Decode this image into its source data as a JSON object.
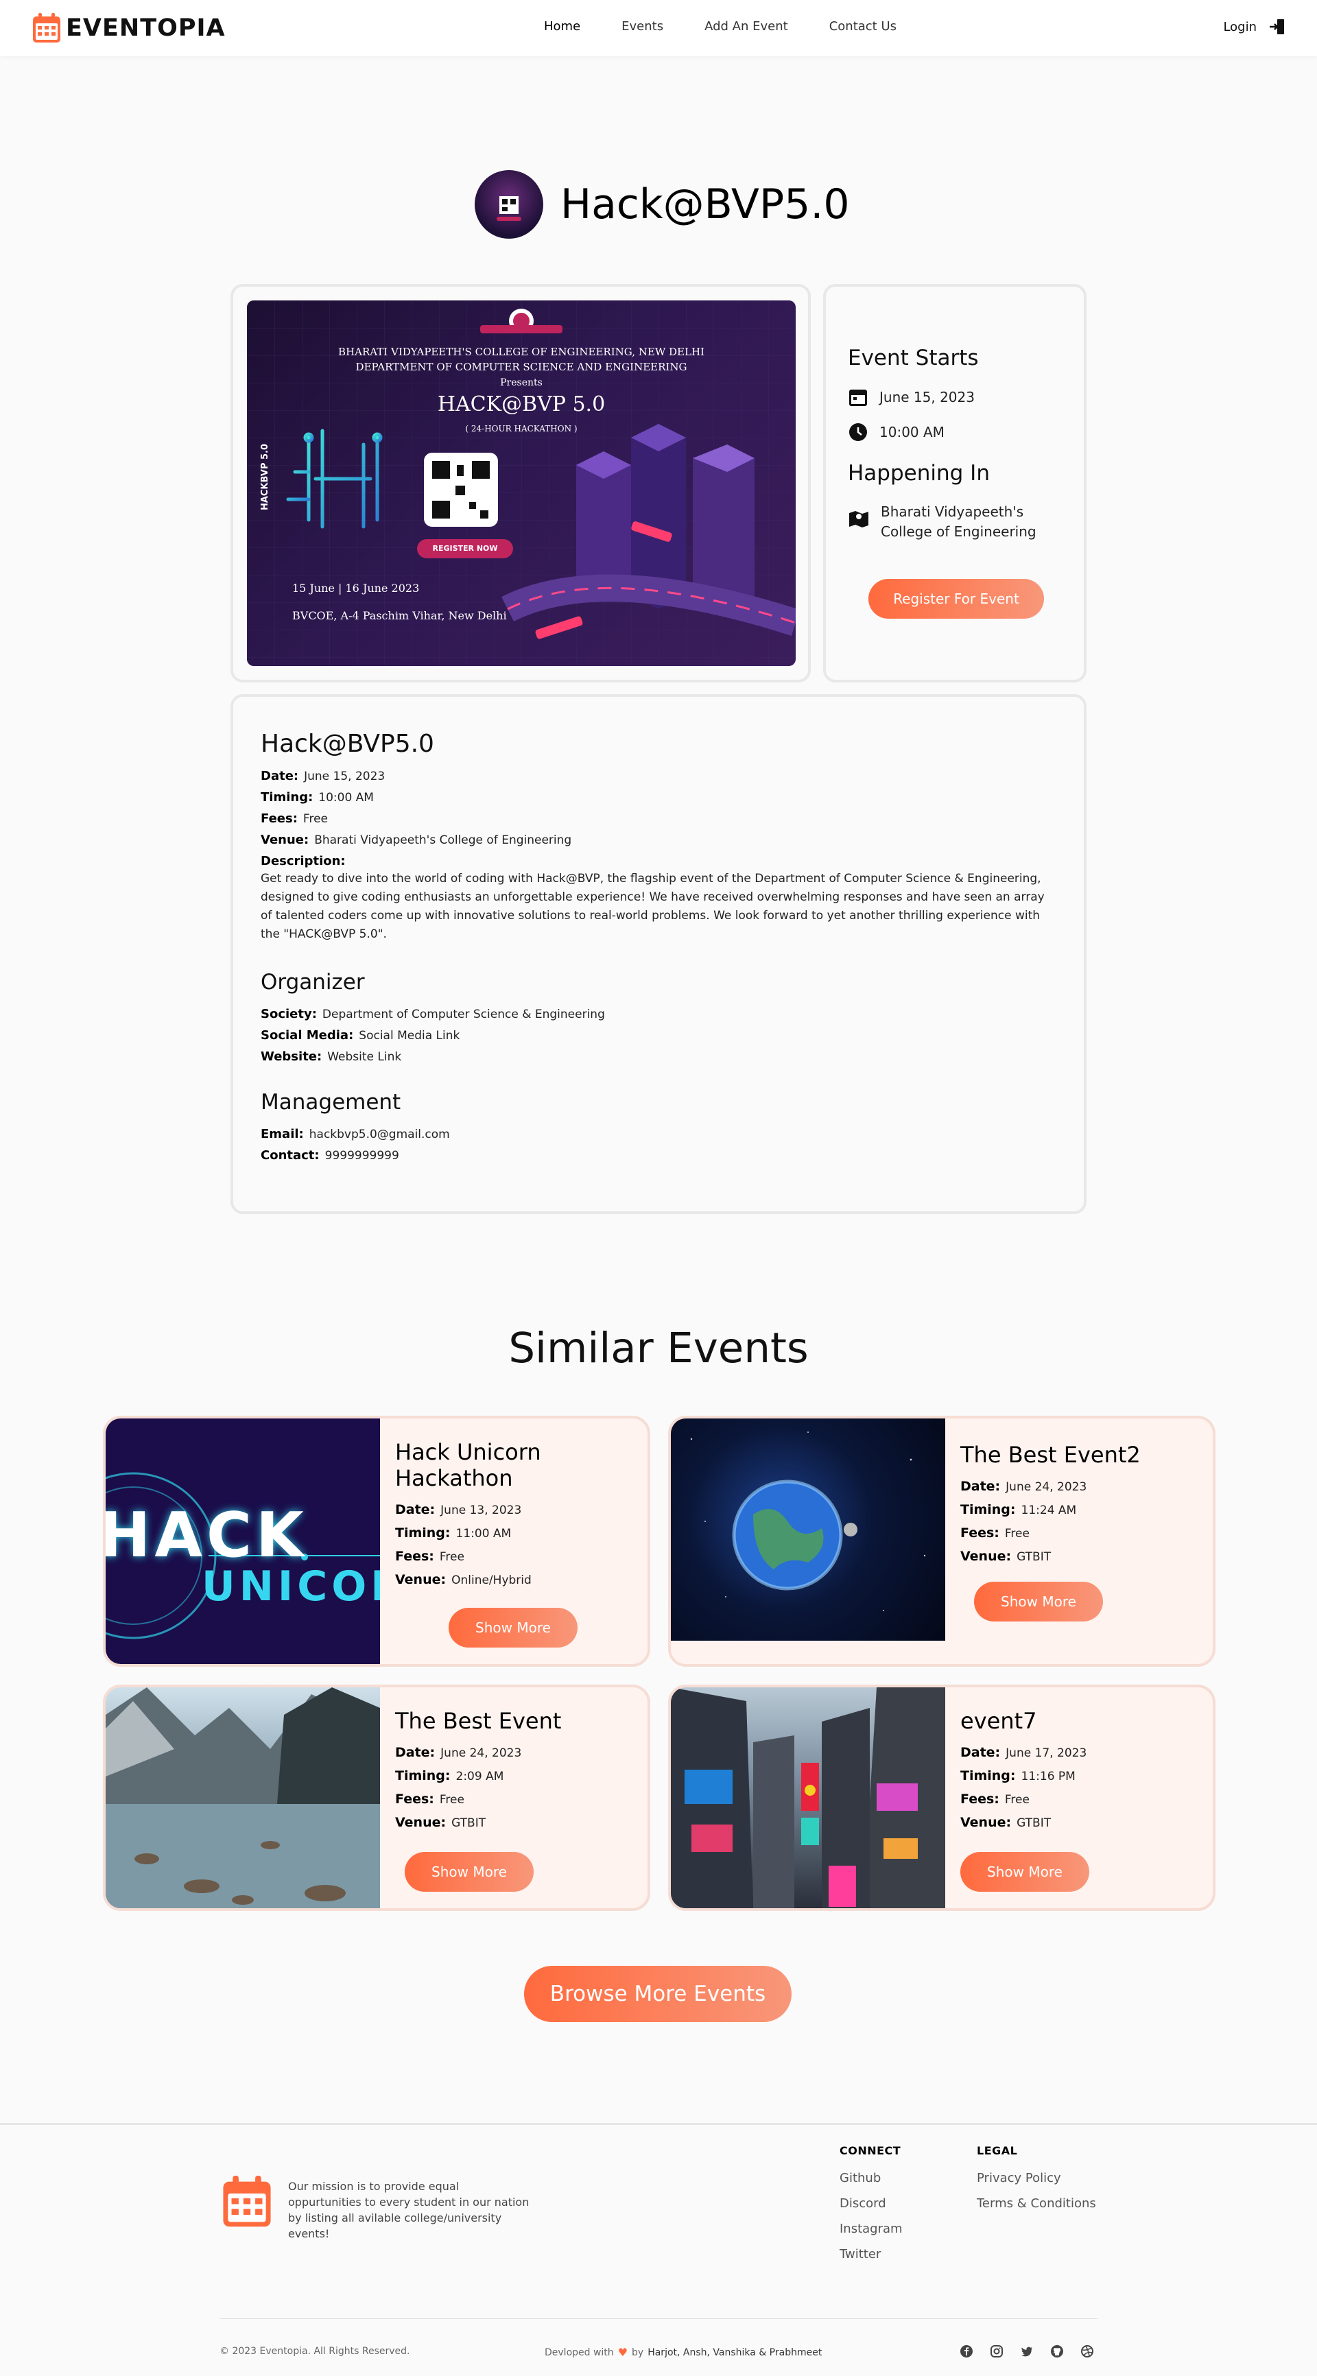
{
  "header": {
    "brand": "EVENTOPIA",
    "nav": [
      "Home",
      "Events",
      "Add An Event",
      "Contact Us"
    ],
    "login": "Login"
  },
  "event": {
    "title": "Hack@BVP5.0",
    "poster": {
      "college": "BHARATI VIDYAPEETH'S COLLEGE OF ENGINEERING, NEW DELHI",
      "dept": "DEPARTMENT OF COMPUTER SCIENCE AND ENGINEERING",
      "presents": "Presents",
      "name": "HACK@BVP 5.0",
      "sub": "( 24-HOUR HACKATHON )",
      "side": "HACKBVP 5.0",
      "register": "REGISTER NOW",
      "dates": "15 June | 16 June 2023",
      "place": "BVCOE, A-4 Paschim Vihar, New Delhi"
    },
    "starts_heading": "Event Starts",
    "start_date": "June 15, 2023",
    "start_time": "10:00 AM",
    "happening_heading": "Happening In",
    "venue_short": "Bharati Vidyapeeth's College of Engineering",
    "register_button": "Register For Event",
    "details": {
      "title": "Hack@BVP5.0",
      "date_label": "Date:",
      "date": "June 15, 2023",
      "timing_label": "Timing:",
      "timing": "10:00 AM",
      "fees_label": "Fees:",
      "fees": "Free",
      "venue_label": "Venue:",
      "venue": "Bharati Vidyapeeth's College of Engineering",
      "desc_label": "Description:",
      "description": "Get ready to dive into the world of coding with Hack@BVP, the flagship event of the Department of Computer Science & Engineering, designed to give coding enthusiasts an unforgettable experience! We have received overwhelming responses and have seen an array of talented coders come up with innovative solutions to real-world problems. We look forward to yet another thrilling experience with the \"HACK@BVP 5.0\".",
      "organizer_heading": "Organizer",
      "society_label": "Society:",
      "society": "Department of Computer Science & Engineering",
      "social_label": "Social Media:",
      "social": "Social Media Link",
      "website_label": "Website:",
      "website": "Website Link",
      "management_heading": "Management",
      "email_label": "Email:",
      "email": "hackbvp5.0@gmail.com",
      "contact_label": "Contact:",
      "contact": "9999999999"
    }
  },
  "similar": {
    "heading": "Similar Events",
    "labels": {
      "date": "Date:",
      "timing": "Timing:",
      "fees": "Fees:",
      "venue": "Venue:",
      "button": "Show More"
    },
    "events": [
      {
        "title": "Hack Unicorn Hackathon",
        "date": "June 13, 2023",
        "timing": "11:00 AM",
        "fees": "Free",
        "venue": "Online/Hybrid",
        "img_text_1": "HACK",
        "img_text_2": "UNICOI"
      },
      {
        "title": "The Best Event2",
        "date": "June 24, 2023",
        "timing": "11:24 AM",
        "fees": "Free",
        "venue": "GTBIT"
      },
      {
        "title": "The Best Event",
        "date": "June 24, 2023",
        "timing": "2:09 AM",
        "fees": "Free",
        "venue": "GTBIT"
      },
      {
        "title": "event7",
        "date": "June 17, 2023",
        "timing": "11:16 PM",
        "fees": "Free",
        "venue": "GTBIT"
      }
    ],
    "browse_button": "Browse More Events"
  },
  "footer": {
    "mission": "Our mission is to provide equal oppurtunities to every student in our nation by listing all avilable college/university events!",
    "connect_heading": "CONNECT",
    "connect": [
      "Github",
      "Discord",
      "Instagram",
      "Twitter"
    ],
    "legal_heading": "LEGAL",
    "legal": [
      "Privacy Policy",
      "Terms & Conditions"
    ],
    "copyright": "© 2023 Eventopia. All Rights Reserved.",
    "dev_prefix": "Devloped with",
    "dev_by": "by",
    "authors": "Harjot, Ansh, Vanshika & Prabhmeet"
  },
  "colors": {
    "accent": "#ff6a3d",
    "accent_light": "#f8977a",
    "card_bg": "#fff3ef"
  }
}
